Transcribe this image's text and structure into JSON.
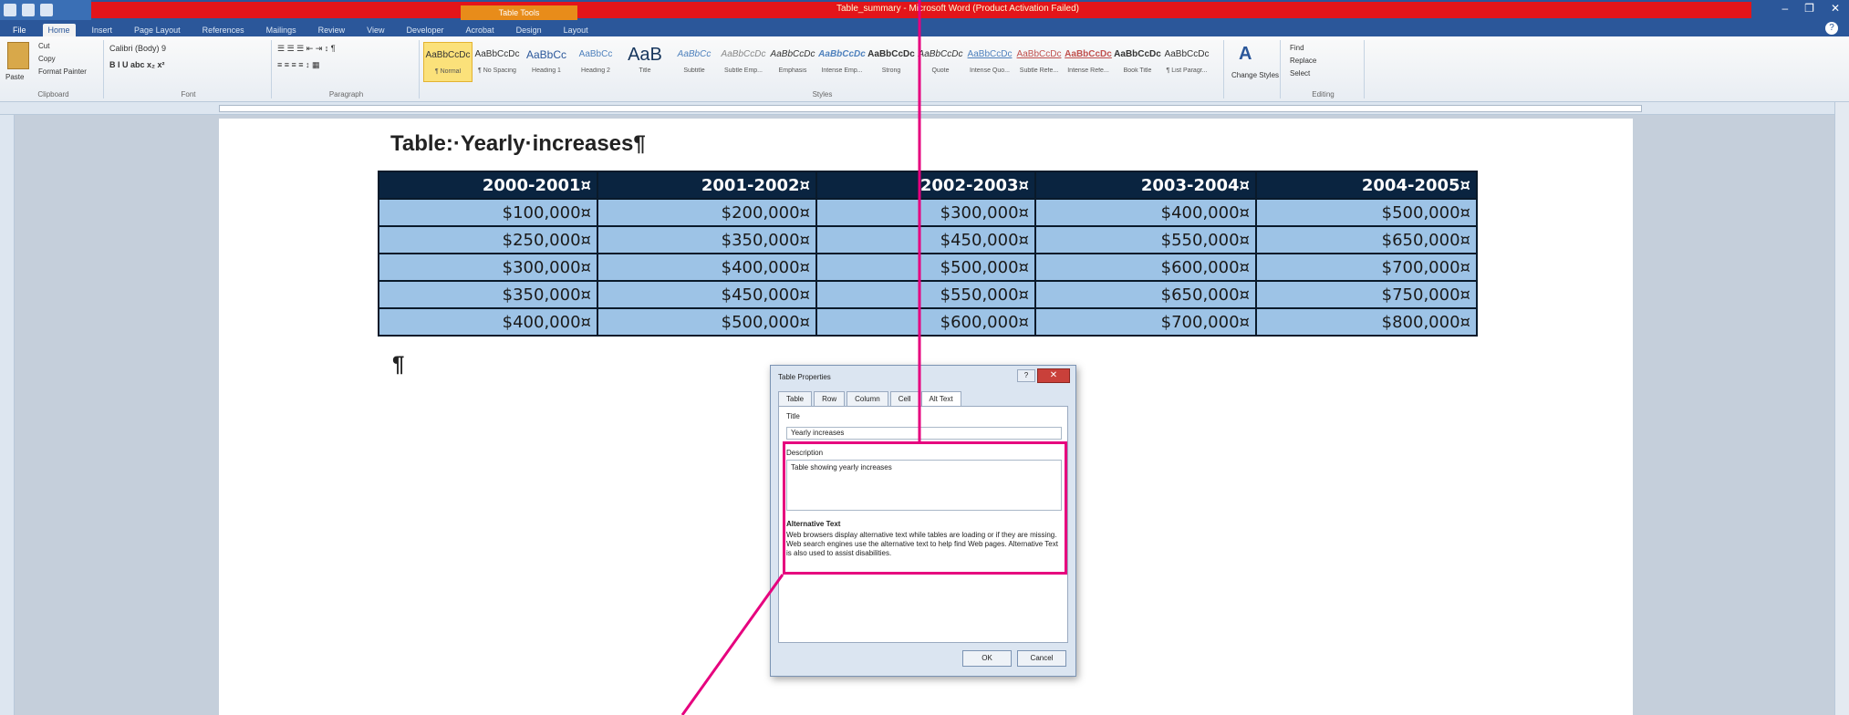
{
  "window": {
    "title": "Table_summary - Microsoft Word (Product Activation Failed)",
    "context_tab": "Table Tools",
    "controls": [
      "–",
      "❐",
      "✕"
    ]
  },
  "ribbon_tabs": [
    {
      "label": "File"
    },
    {
      "label": "Home"
    },
    {
      "label": "Insert"
    },
    {
      "label": "Page Layout"
    },
    {
      "label": "References"
    },
    {
      "label": "Mailings"
    },
    {
      "label": "Review"
    },
    {
      "label": "View"
    },
    {
      "label": "Developer"
    },
    {
      "label": "Acrobat"
    },
    {
      "label": "Design"
    },
    {
      "label": "Layout"
    }
  ],
  "ribbon": {
    "clipboard": {
      "paste": "Paste",
      "cut": "Cut",
      "copy": "Copy",
      "format_painter": "Format Painter",
      "group_label": "Clipboard"
    },
    "font": {
      "font_name": "Calibri (Body)",
      "font_size": "9",
      "format_row": "B  I  U  abc  x₂  x²",
      "group_label": "Font"
    },
    "paragraph": {
      "group_label": "Paragraph"
    },
    "styles": {
      "group_label": "Styles",
      "items": [
        {
          "sample": "AaBbCcDc",
          "name": "¶ Normal"
        },
        {
          "sample": "AaBbCcDc",
          "name": "¶ No Spacing"
        },
        {
          "sample": "AaBbCc",
          "name": "Heading 1"
        },
        {
          "sample": "AaBbCc",
          "name": "Heading 2"
        },
        {
          "sample": "AaB",
          "name": "Title"
        },
        {
          "sample": "AaBbCc",
          "name": "Subtitle"
        },
        {
          "sample": "AaBbCcDc",
          "name": "Subtle Emp..."
        },
        {
          "sample": "AaBbCcDc",
          "name": "Emphasis"
        },
        {
          "sample": "AaBbCcDc",
          "name": "Intense Emp..."
        },
        {
          "sample": "AaBbCcDc",
          "name": "Strong"
        },
        {
          "sample": "AaBbCcDc",
          "name": "Quote"
        },
        {
          "sample": "AaBbCcDc",
          "name": "Intense Quo..."
        },
        {
          "sample": "AaBbCcDc",
          "name": "Subtle Refe..."
        },
        {
          "sample": "AaBbCcDc",
          "name": "Intense Refe..."
        },
        {
          "sample": "AaBbCcDc",
          "name": "Book Title"
        },
        {
          "sample": "AaBbCcDc",
          "name": "¶ List Paragr..."
        }
      ]
    },
    "change_styles": "Change Styles",
    "editing": {
      "find": "Find",
      "replace": "Replace",
      "select": "Select",
      "group_label": "Editing"
    }
  },
  "document": {
    "table_title": "Table:·Yearly·increases¶",
    "paragraph_mark": "¶",
    "table": {
      "headers": [
        "2000-2001¤",
        "2001-2002¤",
        "2002-2003¤",
        "2003-2004¤",
        "2004-2005¤"
      ],
      "rows": [
        [
          "$100,000¤",
          "$200,000¤",
          "$300,000¤",
          "$400,000¤",
          "$500,000¤"
        ],
        [
          "$250,000¤",
          "$350,000¤",
          "$450,000¤",
          "$550,000¤",
          "$650,000¤"
        ],
        [
          "$300,000¤",
          "$400,000¤",
          "$500,000¤",
          "$600,000¤",
          "$700,000¤"
        ],
        [
          "$350,000¤",
          "$450,000¤",
          "$550,000¤",
          "$650,000¤",
          "$750,000¤"
        ],
        [
          "$400,000¤",
          "$500,000¤",
          "$600,000¤",
          "$700,000¤",
          "$800,000¤"
        ]
      ]
    }
  },
  "dialog": {
    "title": "Table Properties",
    "tabs": [
      "Table",
      "Row",
      "Column",
      "Cell",
      "Alt Text"
    ],
    "title_label": "Title",
    "title_value": "Yearly increases",
    "description_label": "Description",
    "description_value": "Table showing yearly increases",
    "alt_heading": "Alternative Text",
    "alt_body": "Web browsers display alternative text while tables are loading or if they are missing.  Web search engines use the alternative text to help find Web pages.  Alternative Text is also used to assist disabilities.",
    "ok": "OK",
    "cancel": "Cancel"
  },
  "colors": {
    "callout": "#e6007e",
    "header_fill": "#0a2440",
    "cell_fill": "#9dc3e6",
    "titlebar_red": "#e3151a"
  }
}
